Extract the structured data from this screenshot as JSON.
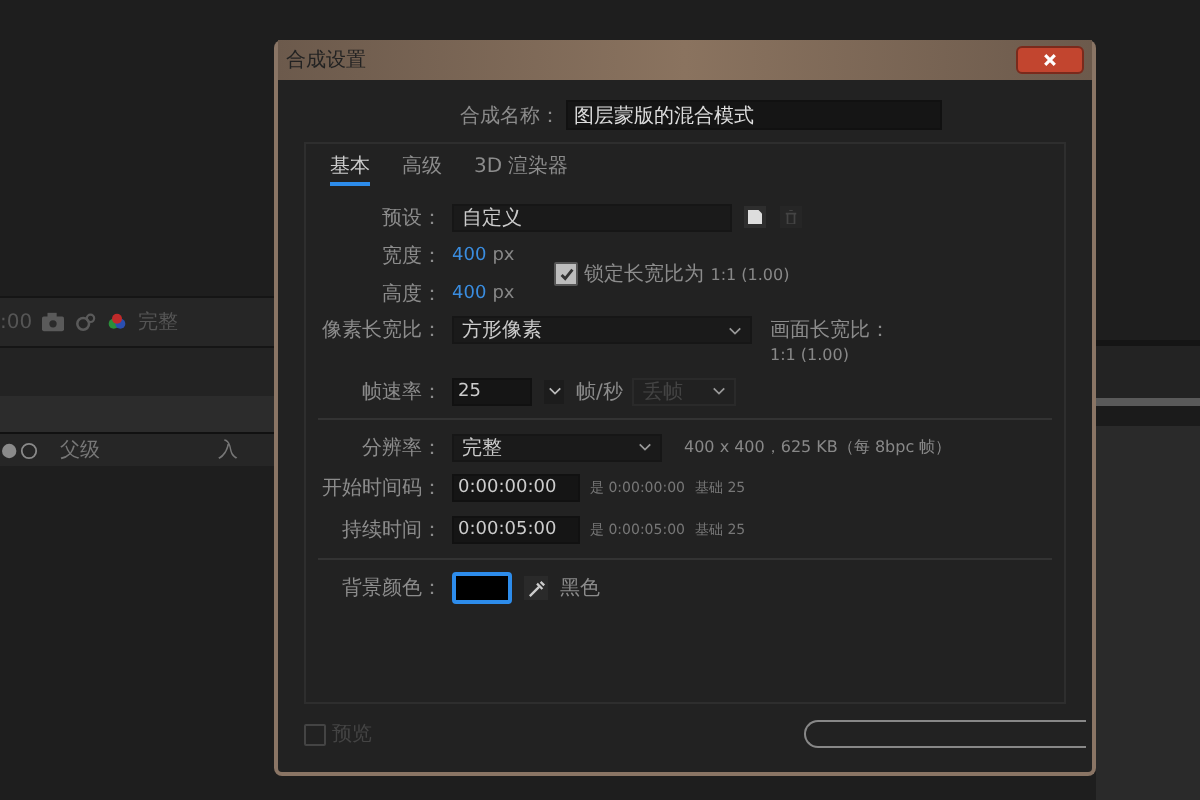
{
  "background_app": {
    "timecode": ":00",
    "view_dropdown": "完整",
    "columns": [
      "父级",
      "入"
    ]
  },
  "window": {
    "title": "合成设置"
  },
  "comp_name": {
    "label": "合成名称：",
    "value": "图层蒙版的混合模式"
  },
  "tabs": [
    {
      "label": "基本",
      "selected": true
    },
    {
      "label": "高级",
      "selected": false
    },
    {
      "label": "3D 渲染器",
      "selected": false
    }
  ],
  "preset": {
    "label": "预设：",
    "value": "自定义"
  },
  "width": {
    "label": "宽度：",
    "value": "400",
    "unit": "px"
  },
  "height": {
    "label": "高度：",
    "value": "400",
    "unit": "px"
  },
  "lock_aspect": {
    "checked": true,
    "label": "锁定长宽比为",
    "value": "1:1 (1.00)"
  },
  "pixel_aspect": {
    "label": "像素长宽比：",
    "value": "方形像素"
  },
  "frame_aspect": {
    "label": "画面长宽比：",
    "value": "1:1 (1.00)"
  },
  "frame_rate": {
    "label": "帧速率：",
    "value": "25",
    "unit": "帧/秒",
    "drop_frame": {
      "value": "丢帧",
      "disabled": true
    }
  },
  "resolution": {
    "label": "分辨率：",
    "value": "完整",
    "info": "400 x 400，625 KB（每 8bpc 帧）"
  },
  "start_timecode": {
    "label": "开始时间码：",
    "value": "0:00:00:00",
    "equals": "是 0:00:00:00",
    "base": "基础 25"
  },
  "duration": {
    "label": "持续时间：",
    "value": "0:00:05:00",
    "equals": "是 0:00:05:00",
    "base": "基础 25"
  },
  "background_color": {
    "label": "背景颜色：",
    "color": "#000000",
    "name": "黑色"
  },
  "preview": {
    "checked": false,
    "label": "预览"
  }
}
